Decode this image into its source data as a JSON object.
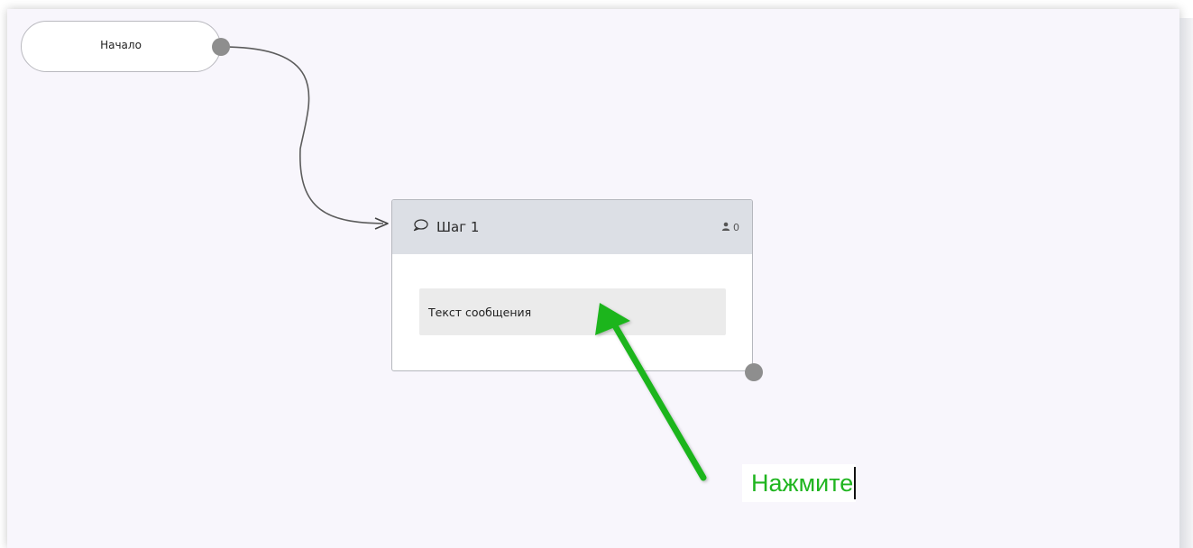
{
  "flow": {
    "start_node": {
      "label": "Начало"
    },
    "step_node": {
      "title": "Шаг 1",
      "subscriber_count": "0",
      "message_text": "Текст сообщения",
      "icon": "speech-bubble-icon",
      "count_icon": "user-icon"
    }
  },
  "annotation": {
    "text": "Нажмите",
    "color": "#1fb51f"
  },
  "colors": {
    "canvas_bg": "#f8f6fc",
    "header_bg": "#dcdfe5",
    "port": "#8e8e8e",
    "connector": "#5a5a5a"
  }
}
